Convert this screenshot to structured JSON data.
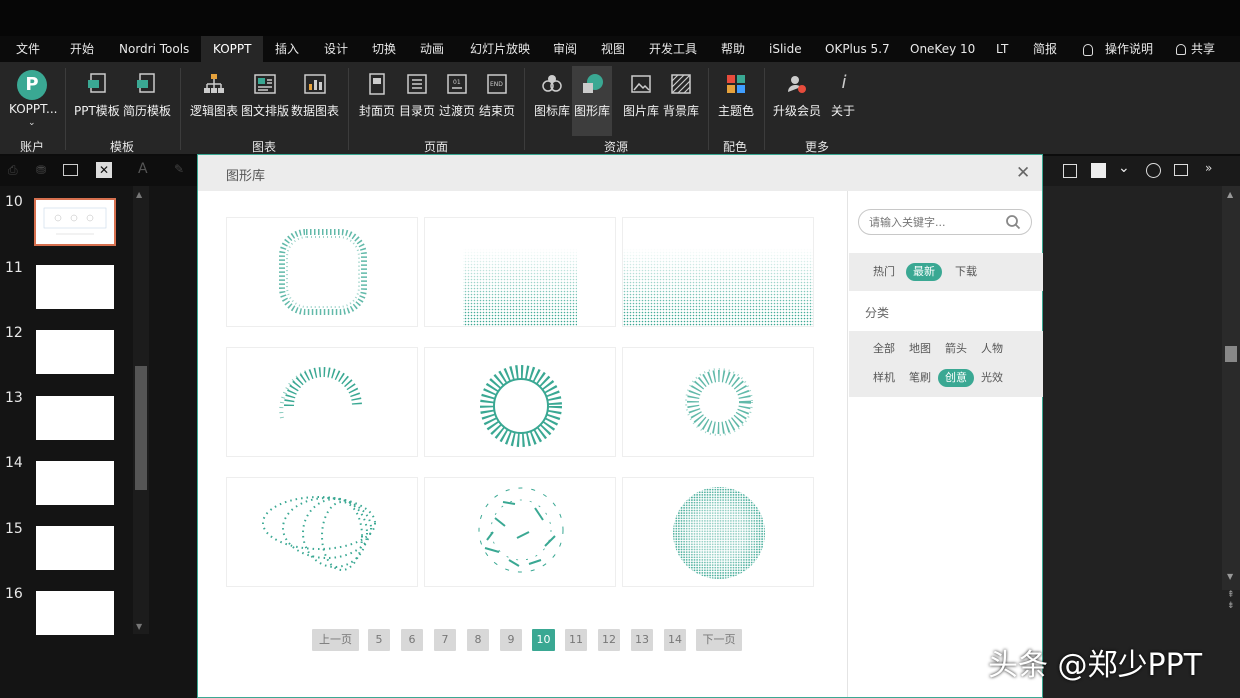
{
  "menu": [
    "文件",
    "开始",
    "Nordri Tools",
    "KOPPT",
    "插入",
    "设计",
    "切换",
    "动画",
    "幻灯片放映",
    "审阅",
    "视图",
    "开发工具",
    "帮助",
    "iSlide",
    "OKPlus 5.7",
    "OneKey 10",
    "LT",
    "简报",
    "操作说明",
    "共享"
  ],
  "ribbon": {
    "buttons": [
      "KOPPT...",
      "PPT模板",
      "简历模板",
      "逻辑图表",
      "图文排版",
      "数据图表",
      "封面页",
      "目录页",
      "过渡页",
      "结束页",
      "图标库",
      "图形库",
      "图片库",
      "背景库",
      "主题色",
      "升级会员",
      "关于"
    ],
    "groups": [
      "账户",
      "模板",
      "图表",
      "页面",
      "资源",
      "配色",
      "更多"
    ]
  },
  "slides": [
    "10",
    "11",
    "12",
    "13",
    "14",
    "15",
    "16"
  ],
  "dialog": {
    "title": "图形库",
    "search_placeholder": "请输入关键字...",
    "sort": [
      "热门",
      "最新",
      "下载"
    ],
    "category_label": "分类",
    "categories": [
      "全部",
      "地图",
      "箭头",
      "人物",
      "样机",
      "笔刷",
      "创意",
      "光效"
    ],
    "pager": [
      "上一页",
      "5",
      "6",
      "7",
      "8",
      "9",
      "10",
      "11",
      "12",
      "13",
      "14",
      "下一页"
    ],
    "current_page": "10",
    "active_sort": "最新",
    "active_category": "创意"
  },
  "watermark": "头条 @郑少PPT",
  "colors": {
    "accent": "#3aa893",
    "ribbon": "#262626",
    "dark": "#0b0b0b"
  }
}
